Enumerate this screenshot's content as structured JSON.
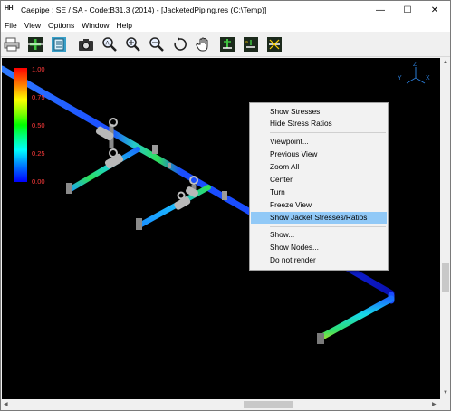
{
  "window": {
    "app_icon": "HH",
    "title": "Caepipe : SE / SA - Code:B31.3 (2014) -  [JacketedPiping.res (C:\\Temp)]",
    "minimize": "—",
    "maximize": "☐",
    "close": "✕"
  },
  "menubar": {
    "items": [
      "File",
      "View",
      "Options",
      "Window",
      "Help"
    ]
  },
  "toolbar": {
    "buttons": [
      "print-icon",
      "add-node-icon",
      "notes-icon",
      "camera-icon",
      "zoom-window-icon",
      "zoom-in-icon",
      "zoom-out-icon",
      "rotate-icon",
      "pan-icon",
      "show-support-icon",
      "show-section-icon",
      "show-node-icon"
    ]
  },
  "legend": {
    "labels": [
      "1.00",
      "0.75",
      "0.50",
      "0.25",
      "0.00"
    ],
    "label_color": "#ff3b3b"
  },
  "axes": {
    "x": "X",
    "y": "Y",
    "z": "Z",
    "color": "#2a7bd4"
  },
  "context_menu": {
    "items": [
      {
        "label": "Show Stresses"
      },
      {
        "label": "Hide Stress Ratios"
      },
      {
        "label": "Viewpoint..."
      },
      {
        "label": "Previous View"
      },
      {
        "label": "Zoom All"
      },
      {
        "label": "Center"
      },
      {
        "label": "Turn"
      },
      {
        "label": "Freeze View"
      },
      {
        "label": "Show Jacket Stresses/Ratios",
        "highlighted": true
      },
      {
        "label": "Show..."
      },
      {
        "label": "Show Nodes..."
      },
      {
        "label": "Do not render"
      }
    ]
  },
  "colors": {
    "viewport_bg": "#000000",
    "menu_highlight": "#91c9f7",
    "pipe_blue": "#1a56ff",
    "pipe_green": "#27e06a"
  }
}
